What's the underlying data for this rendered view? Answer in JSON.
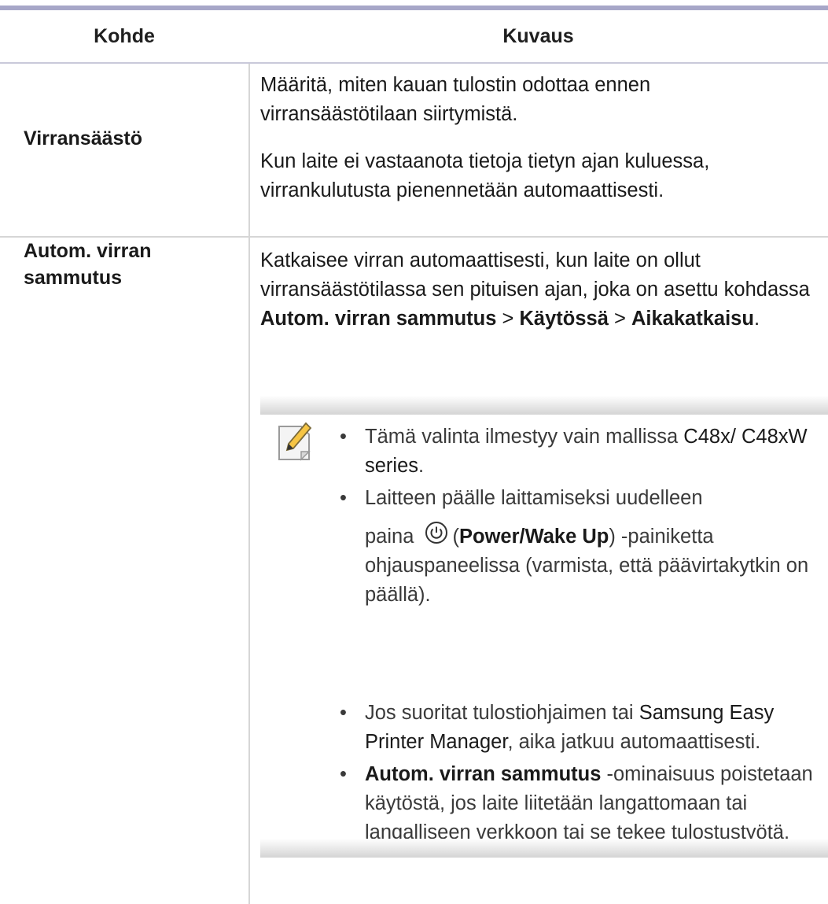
{
  "table": {
    "header": {
      "col1": "Kohde",
      "col2": "Kuvaus"
    },
    "rows": [
      {
        "item": "Virransäästö",
        "paragraphs": [
          "Määritä, miten kauan tulostin odottaa ennen virransäästötilaan siirtymistä.",
          "Kun laite ei vastaanota tietoja tietyn ajan kuluessa, virrankulutusta pienennetään automaattisesti."
        ]
      },
      {
        "item_line1": "Autom. virran",
        "item_line2": "sammutus",
        "desc_start": "Katkaisee virran automaattisesti, kun laite on ollut virransäästötilassa sen pituisen ajan, joka on asettu kohdassa",
        "desc_bold1": "Autom. virran sammutus",
        "desc_sep1": ">",
        "desc_bold2": "Käytössä",
        "desc_sep2": ">",
        "desc_bold3": "Aikakatkaisu",
        "desc_end": ".",
        "note": {
          "icon": "note-pencil-icon",
          "bullets": {
            "b1_text": "Tämä valinta ilmestyy vain mallissa",
            "b1_model": "C48x/ C48xW series",
            "b1_end": ".",
            "b2_line1": "Laitteen päälle laittamiseksi uudelleen",
            "b2_paina": "paina",
            "b2_icon": "power-icon",
            "b2_open": "(",
            "b2_bold": "Power/Wake Up",
            "b2_rest": ") -painiketta ohjauspaneelissa (varmista, että päävirtakytkin on päällä).",
            "b3_text": "Jos suoritat tulostiohjaimen tai",
            "b3_app": "Samsung Easy Printer Manager",
            "b3_rest": ", aika jatkuu automaattisesti.",
            "b4_bold": "Autom. virran sammutus",
            "b4_rest": "-ominaisuus poistetaan käytöstä, jos laite liitetään langattomaan tai langalliseen verkkoon tai se tekee tulostustyötä."
          }
        }
      }
    ]
  }
}
